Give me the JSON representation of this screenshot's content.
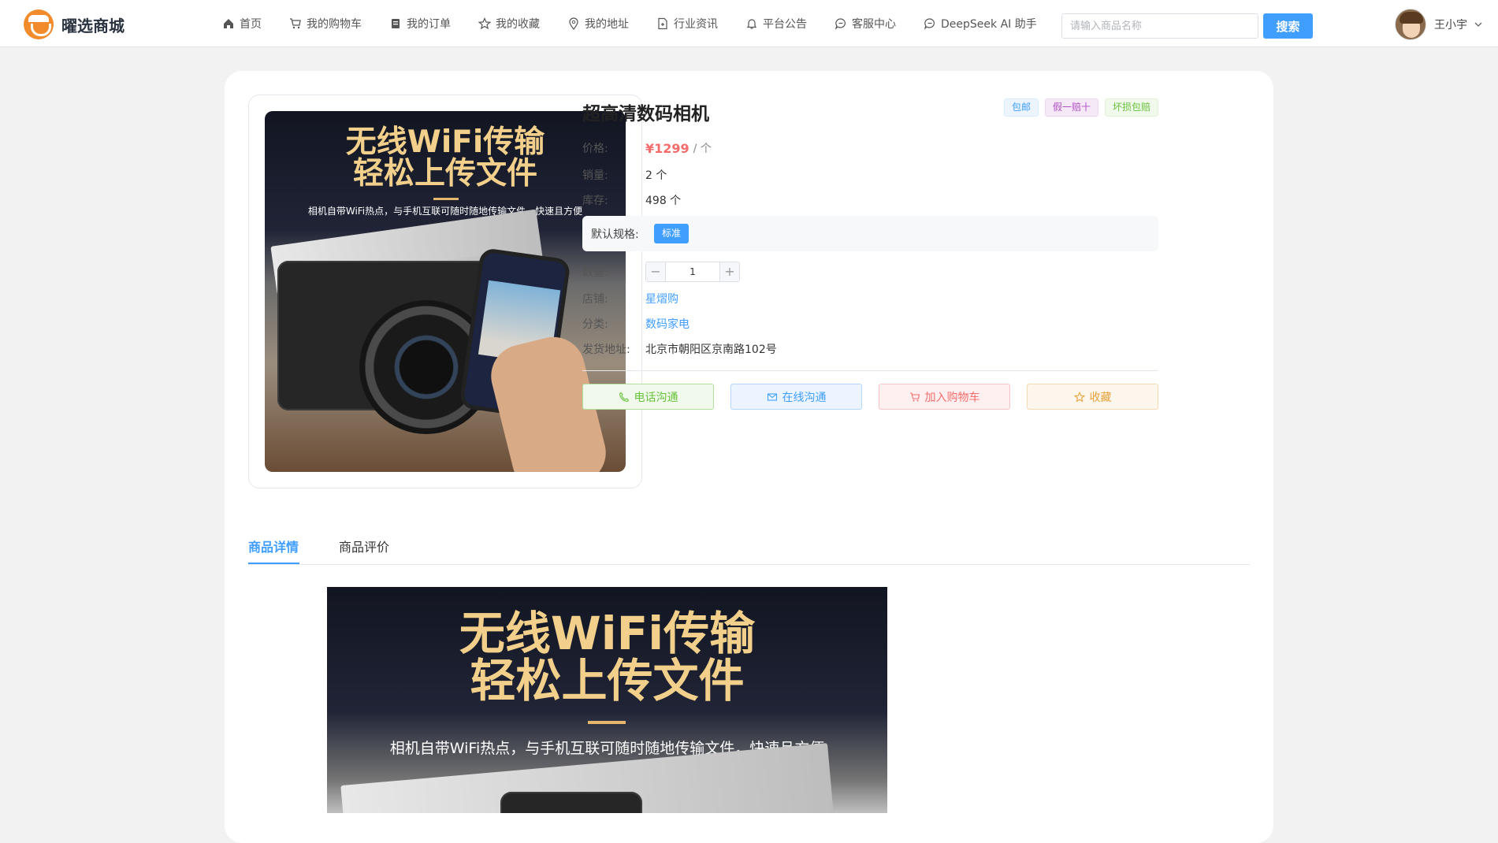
{
  "brand": {
    "name": "曜选商城",
    "color": "#f28b2c"
  },
  "nav": [
    {
      "icon": "home-icon",
      "label": "首页"
    },
    {
      "icon": "cart-icon",
      "label": "我的购物车"
    },
    {
      "icon": "order-icon",
      "label": "我的订单"
    },
    {
      "icon": "star-icon",
      "label": "我的收藏"
    },
    {
      "icon": "location-icon",
      "label": "我的地址"
    },
    {
      "icon": "news-icon",
      "label": "行业资讯"
    },
    {
      "icon": "bell-icon",
      "label": "平台公告"
    },
    {
      "icon": "chat-icon",
      "label": "客服中心"
    },
    {
      "icon": "chat-icon",
      "label": "DeepSeek AI 助手"
    }
  ],
  "search": {
    "placeholder": "请输入商品名称",
    "button": "搜索"
  },
  "user": {
    "name": "王小宇"
  },
  "product": {
    "title": "超高清数码相机",
    "tags": [
      "包邮",
      "假一赔十",
      "坏损包赔"
    ],
    "price_label": "价格:",
    "price": "¥1299",
    "price_unit": "/ 个",
    "sales_label": "销量:",
    "sales": "2 个",
    "stock_label": "库存:",
    "stock": "498 个",
    "spec_label": "默认规格:",
    "spec_value": "标准",
    "qty_label": "数量:",
    "quantity": "1",
    "qty_minus": "−",
    "qty_plus": "+",
    "shop_label": "店铺:",
    "shop": "星熠购",
    "category_label": "分类:",
    "category": "数码家电",
    "address_label": "发货地址:",
    "address": "北京市朝阳区京南路102号",
    "actions": [
      "电话沟通",
      "在线沟通",
      "加入购物车",
      "收藏"
    ]
  },
  "image_text": {
    "line1": "无线WiFi传输",
    "line2": "轻松上传文件",
    "subtitle": "相机自带WiFi热点，与手机互联可随时随地传输文件，快速且方便"
  },
  "tabs": [
    "商品详情",
    "商品评价"
  ],
  "colors": {
    "accent": "#409eff",
    "price": "#f56c6c"
  }
}
